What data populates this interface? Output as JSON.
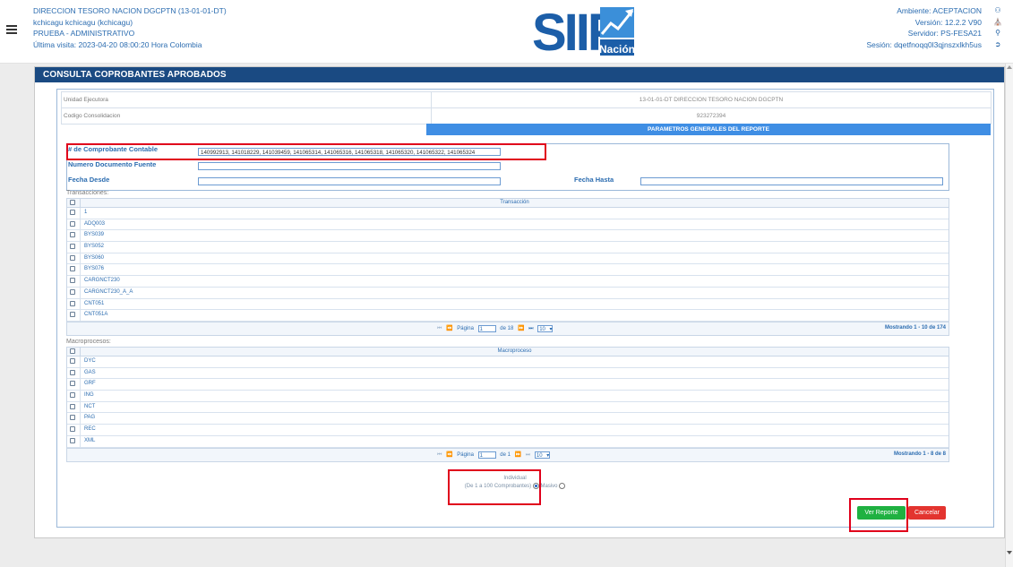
{
  "header": {
    "left_lines": [
      "DIRECCION TESORO NACION DGCPTN (13-01-01-DT)",
      "kchicagu kchicagu (kchicagu)",
      "PRUEBA - ADMINISTRATIVO",
      "Última visita: 2023-04-20 08:00:20 Hora Colombia"
    ],
    "logo_text": "SIIF",
    "logo_sub": "Nación",
    "right_lines": [
      "Ambiente: ACEPTACION",
      "Versión: 12.2.2 V90",
      "Servidor: PS-FESA21",
      "Sesión: dqetfnoqq0l3qjnszxlkh5us"
    ],
    "right_icons": [
      "users-icon",
      "bank-icon",
      "key-icon",
      "logout-icon"
    ]
  },
  "panel": {
    "title": "CONSULTA COPROBANTES APROBADOS",
    "info_rows": [
      {
        "label": "Unidad Ejecutora",
        "value": "13-01-01-DT DIRECCION TESORO NACION DGCPTN"
      },
      {
        "label": "Codigo Consolidacion",
        "value": "923272394"
      }
    ],
    "params_header": "PARAMETROS GENERALES DEL REPORTE",
    "fields": {
      "comprobante_label": "# de Comprobante Contable",
      "comprobante_value": "140992913, 141018229, 141039459, 141065314, 141065316, 141065318, 141065320, 141065322, 141065324",
      "documento_label": "Numero Documento Fuente",
      "documento_value": "",
      "fecha_desde_label": "Fecha Desde",
      "fecha_desde_value": "",
      "fecha_hasta_label": "Fecha Hasta",
      "fecha_hasta_value": ""
    },
    "transacciones": {
      "section_label": "Transacciones:",
      "column": "Transacción",
      "rows": [
        "1",
        "ADQ003",
        "BYS039",
        "BYS052",
        "BYS060",
        "BYS076",
        "CARGNCT230",
        "CARGNCT230_A_A",
        "CNT051",
        "CNT051A"
      ],
      "page_label": "Página",
      "page_value": "1",
      "page_of": "de 18",
      "page_size": "10",
      "showing": "Mostrando 1 - 10 de 174"
    },
    "macroprocesos": {
      "section_label": "Macroprocesos:",
      "column": "Macroproceso",
      "rows": [
        "DYC",
        "GAS",
        "GRF",
        "ING",
        "NCT",
        "PAG",
        "REC",
        "XML"
      ],
      "page_label": "Página",
      "page_value": "1",
      "page_of": "de 1",
      "page_size": "10",
      "showing": "Mostrando 1 - 8 de 8"
    },
    "mode": {
      "individual_label": "Individual",
      "range_label": "(De 1 a 100 Comprobantes)",
      "masivo_label": "Masivo",
      "selected": "individual"
    },
    "buttons": {
      "ver_reporte": "Ver Reporte",
      "cancelar": "Cancelar"
    }
  },
  "colors": {
    "title_bar": "#1a4a82",
    "params_header": "#3f8ee4",
    "highlight": "#e0001b",
    "ver_reporte": "#1fb141",
    "cancelar": "#e3342f"
  }
}
